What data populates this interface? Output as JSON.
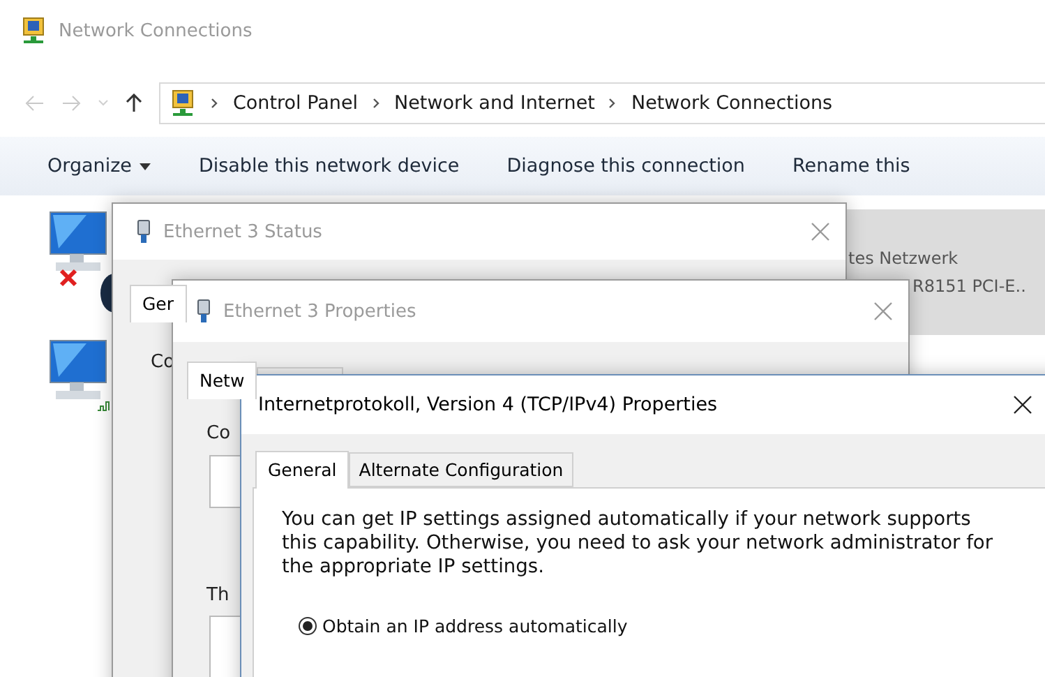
{
  "explorer": {
    "title": "Network Connections",
    "breadcrumbs": [
      "Control Panel",
      "Network and Internet",
      "Network Connections"
    ],
    "toolbar": [
      {
        "label": "Organize",
        "dropdown": true
      },
      {
        "label": "Disable this network device",
        "dropdown": false
      },
      {
        "label": "Diagnose this connection",
        "dropdown": false
      },
      {
        "label": "Rename this",
        "dropdown": false
      }
    ],
    "connections": [
      {
        "disconnected": true
      },
      {
        "disconnected": false
      }
    ],
    "selected_item": {
      "selected": true,
      "lines": [
        "tes Netzwerk",
        "R8151 PCI-E.."
      ]
    }
  },
  "status_dialog": {
    "title": "Ethernet 3 Status",
    "tab": "Ger",
    "label": "Co"
  },
  "properties_dialog": {
    "title": "Ethernet 3 Properties",
    "tab": "Netw",
    "labels": [
      "Co",
      "Th"
    ]
  },
  "ipv4_dialog": {
    "title": "Internetprotokoll, Version 4 (TCP/IPv4) Properties",
    "tabs": [
      {
        "label": "General",
        "selected": true
      },
      {
        "label": "Alternate Configuration",
        "selected": false
      }
    ],
    "description": "You can get IP settings assigned automatically if your network supports this capability. Otherwise, you need to ask your network administrator for the appropriate IP settings.",
    "options": [
      {
        "label": "Obtain an IP address automatically",
        "selected": true
      }
    ]
  }
}
